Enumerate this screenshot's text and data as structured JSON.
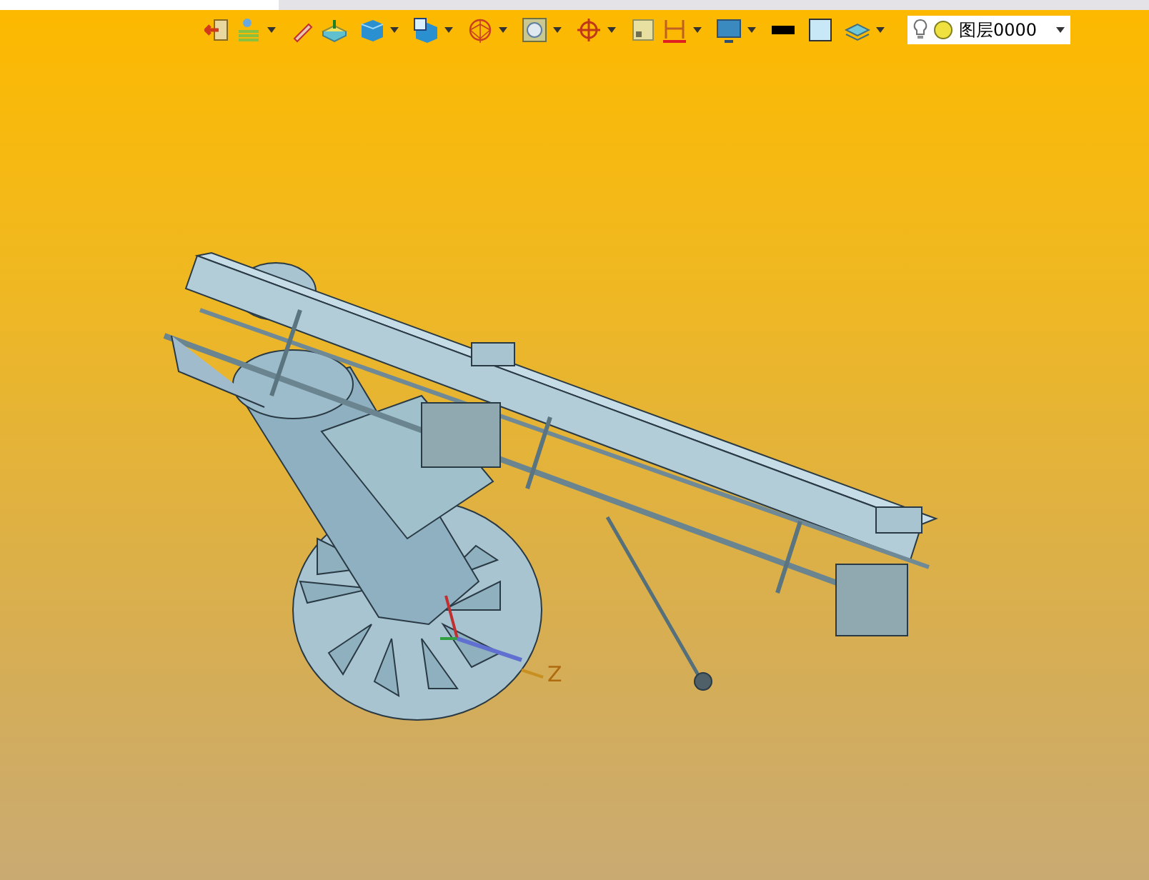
{
  "toolbar": {
    "buttons": [
      {
        "dropdown": false
      },
      {
        "dropdown": true
      },
      {
        "dropdown": false
      },
      {
        "dropdown": false
      },
      {
        "dropdown": true
      },
      {
        "dropdown": true
      },
      {
        "dropdown": true
      },
      {
        "dropdown": true
      },
      {
        "dropdown": true
      },
      {
        "dropdown": false
      },
      {
        "dropdown": true
      },
      {
        "dropdown": true
      },
      {
        "dropdown": false
      },
      {
        "dropdown": false
      },
      {
        "dropdown": true
      }
    ],
    "layer_combo": {
      "value": "图层0000"
    }
  },
  "viewport": {
    "axis_label": "Z"
  }
}
